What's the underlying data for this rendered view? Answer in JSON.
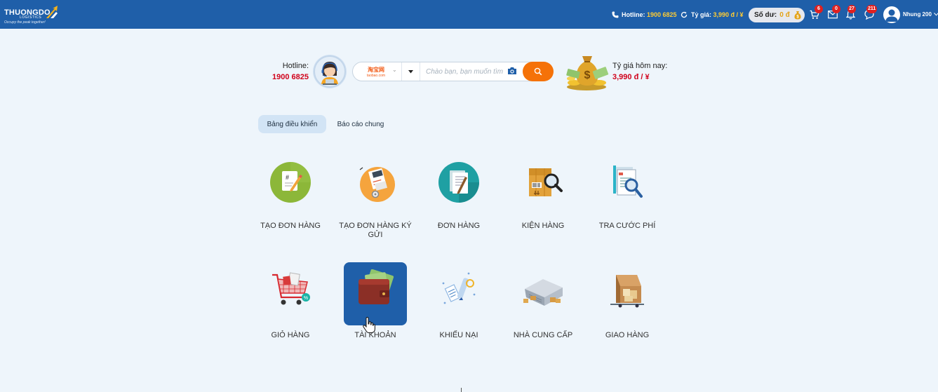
{
  "topbar": {
    "logo_text": "THUONGDO",
    "logo_sub": "LOGISTICS",
    "logo_slogan": "Occupy the peak together!",
    "hotline_label": "Hotline:",
    "hotline_number": "1900 6825",
    "rate_label": "Tỷ giá:",
    "rate_value": "3,990 đ / ¥",
    "balance_label": "Số dư:",
    "balance_value": "0 đ",
    "cart_count": "6",
    "mail_count": "0",
    "notify_count": "27",
    "message_count": "211",
    "username": "Nhung 200"
  },
  "search": {
    "hotline_label": "Hotline:",
    "hotline_number": "1900 6825",
    "store_name": "淘宝网",
    "store_domain": "taobao.com",
    "placeholder": "Chào bạn, bạn muốn tìm gì hôm nay?",
    "rate_label": "Tỷ giá hôm nay:",
    "rate_value": "3,990 đ / ¥"
  },
  "tabs": [
    {
      "label": "Bảng điều khiển",
      "active": true
    },
    {
      "label": "Báo cáo chung",
      "active": false
    }
  ],
  "tiles": [
    {
      "label": "TẠO ĐƠN HÀNG",
      "icon": "create-order-icon"
    },
    {
      "label": "TẠO ĐƠN HÀNG KÝ GỬI",
      "icon": "consignment-order-icon"
    },
    {
      "label": "ĐƠN HÀNG",
      "icon": "orders-icon"
    },
    {
      "label": "KIỆN HÀNG",
      "icon": "packages-icon"
    },
    {
      "label": "TRA CƯỚC PHÍ",
      "icon": "fee-lookup-icon"
    },
    {
      "label": "GIỎ HÀNG",
      "icon": "cart-icon"
    },
    {
      "label": "TÀI KHOẢN",
      "icon": "wallet-icon"
    },
    {
      "label": "KHIẾU NẠI",
      "icon": "complaint-icon"
    },
    {
      "label": "NHÀ CUNG CẤP",
      "icon": "supplier-icon"
    },
    {
      "label": "GIAO HÀNG",
      "icon": "delivery-icon"
    }
  ],
  "colors": {
    "header": "#1f5fa9",
    "accent": "#f57208",
    "price_red": "#d0021b",
    "highlight_yellow": "#ffcc33"
  }
}
